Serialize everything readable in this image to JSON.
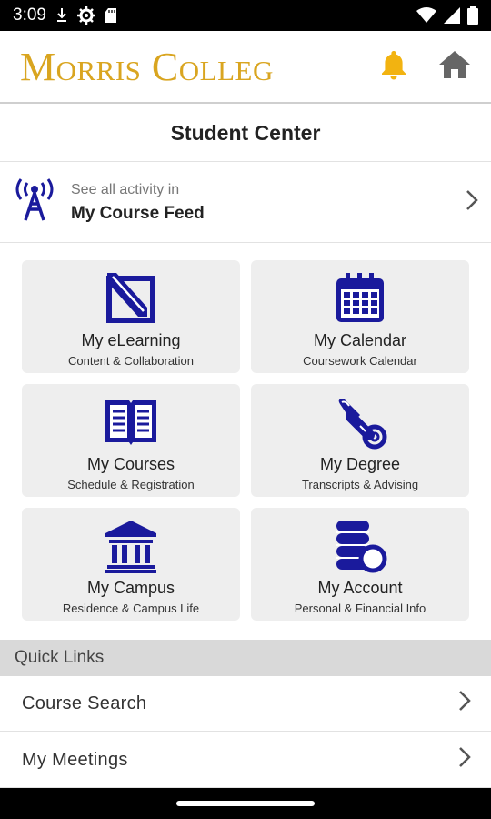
{
  "status_bar": {
    "time": "3:09",
    "icons": [
      "download-icon",
      "settings-icon",
      "sd-card-icon",
      "wifi-icon",
      "signal-icon",
      "battery-icon"
    ]
  },
  "header": {
    "logo_text": "Morris Colleg",
    "logo_color": "#d9a520",
    "bell_color": "#f2b311",
    "home_color": "#666666"
  },
  "page": {
    "title": "Student Center"
  },
  "feed": {
    "subtitle": "See all activity in",
    "title": "My Course Feed",
    "icon": "antenna-icon"
  },
  "accent_color": "#1a1a9c",
  "tiles": [
    {
      "title": "My eLearning",
      "subtitle": "Content & Collaboration",
      "icon": "pencil-paper-icon"
    },
    {
      "title": "My Calendar",
      "subtitle": "Coursework Calendar",
      "icon": "calendar-icon"
    },
    {
      "title": "My Courses",
      "subtitle": "Schedule & Registration",
      "icon": "open-book-icon"
    },
    {
      "title": "My Degree",
      "subtitle": "Transcripts & Advising",
      "icon": "diploma-icon"
    },
    {
      "title": "My Campus",
      "subtitle": "Residence & Campus Life",
      "icon": "building-icon"
    },
    {
      "title": "My Account",
      "subtitle": "Personal & Financial Info",
      "icon": "coins-icon"
    }
  ],
  "quick_links": {
    "header": "Quick Links",
    "items": [
      {
        "label": "Course Search"
      },
      {
        "label": "My Meetings"
      }
    ]
  }
}
